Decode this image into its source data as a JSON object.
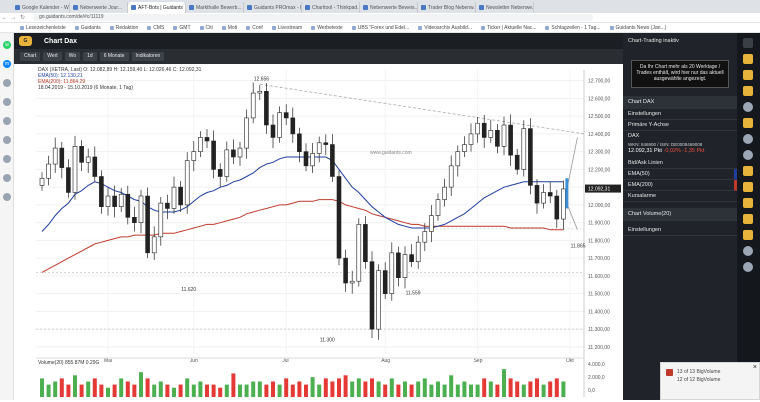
{
  "browser": {
    "tabs": [
      "Google Kalender - W...",
      "Nebenwerte Jour...",
      "AFT-Bots | Guidants",
      "Markthalle Bewerb...",
      "Guidants PROmax - H...",
      "Charttool - Thinkpad...",
      "Nebenwerte Beweis...",
      "Trader Blog Nebenw...",
      "Newsletter Nebenwe..."
    ],
    "url": "go.guidants.com/de/#c/11119",
    "bookmarks": [
      "Lesezeichenleiste",
      "Guidants",
      "Redaktion",
      "CMS",
      "GMT",
      "Citi",
      "Moti",
      "Conf",
      "Livestream",
      "Werbetexte",
      "UBS \"Forex und Edel...",
      "Videoarchiv Ausbild...",
      "Ticker | Aktuelle Nac...",
      "Schlagzeilen - 1 Tag...",
      "Guidants News (Jan...)"
    ]
  },
  "app": {
    "title": "Chart Dax",
    "toolbar": [
      "Chart",
      "Wert",
      "Wo",
      "1d",
      "6 Monate",
      "Indikatoren"
    ]
  },
  "legend": {
    "line1": "DAX (XETRA, Last) O: 12.082,89  H: 12.159,40  L: 12.026,46  C: 12.092,31",
    "line2": "EMA(50): 12.130,21",
    "line3": "EMA(200): 11.864,29",
    "line4": "18.04.2019 - 15.10.2019  (6 Monate, 1 Tag)"
  },
  "chart_data": {
    "type": "candlestick",
    "title": "",
    "instrument": "DAX",
    "x_labels": [
      "Mai",
      "Jun",
      "Jul",
      "Aug",
      "Sep",
      "Okt"
    ],
    "y_ticks": [
      11200,
      11300,
      11400,
      11500,
      11600,
      11700,
      11800,
      11900,
      12000,
      12100,
      12200,
      12300,
      12400,
      12500,
      12600,
      12700
    ],
    "y_tick_labels": [
      "11.200,00",
      "11.300,00",
      "11.400,00",
      "11.500,00",
      "11.600,00",
      "11.700,00",
      "11.800,00",
      "11.900,00",
      "12.000,00",
      "12.100,00",
      "12.200,00",
      "12.300,00",
      "12.400,00",
      "12.500,00",
      "12.600,00",
      "12.700,00"
    ],
    "ylim": [
      11160,
      12760
    ],
    "last_price_label": "12.092,31",
    "watermark": "www.guidants.com",
    "closes": [
      12150,
      12230,
      12320,
      12210,
      12070,
      12330,
      12240,
      12270,
      12160,
      11990,
      12050,
      11990,
      12060,
      11930,
      11900,
      12050,
      11730,
      11820,
      12010,
      11980,
      12100,
      12000,
      12250,
      12300,
      12380,
      12360,
      12200,
      12160,
      12310,
      12270,
      12320,
      12490,
      12630,
      12640,
      12450,
      12380,
      12520,
      12490,
      12400,
      12300,
      12220,
      12290,
      12350,
      12340,
      12160,
      11700,
      11560,
      11570,
      11890,
      11680,
      11300,
      11630,
      11500,
      11730,
      11590,
      11720,
      11680,
      11790,
      11850,
      11940,
      12030,
      12100,
      12220,
      12300,
      12340,
      12400,
      12460,
      12380,
      12420,
      12330,
      12450,
      12280,
      12200,
      12430,
      12110,
      12010,
      12070,
      12050,
      11920,
      12090
    ],
    "ema50": [
      11850,
      11890,
      11940,
      11980,
      12010,
      12060,
      12080,
      12110,
      12130,
      12120,
      12100,
      12080,
      12070,
      12050,
      12030,
      12020,
      11990,
      11970,
      11960,
      11960,
      11960,
      11970,
      11990,
      12020,
      12050,
      12070,
      12080,
      12100,
      12110,
      12130,
      12140,
      12160,
      12180,
      12210,
      12230,
      12240,
      12260,
      12270,
      12270,
      12270,
      12270,
      12270,
      12270,
      12270,
      12250,
      12200,
      12150,
      12100,
      12070,
      12030,
      11990,
      11960,
      11930,
      11910,
      11890,
      11880,
      11870,
      11870,
      11870,
      11870,
      11880,
      11890,
      11910,
      11930,
      11950,
      11980,
      12010,
      12040,
      12060,
      12080,
      12100,
      12110,
      12120,
      12130,
      12130,
      12130,
      12130,
      12130,
      12130,
      12130
    ],
    "ema200": [
      11620,
      11640,
      11660,
      11680,
      11700,
      11720,
      11740,
      11760,
      11780,
      11790,
      11800,
      11810,
      11820,
      11820,
      11830,
      11830,
      11830,
      11830,
      11840,
      11840,
      11840,
      11850,
      11860,
      11870,
      11880,
      11890,
      11890,
      11900,
      11910,
      11920,
      11930,
      11950,
      11960,
      11970,
      11980,
      11990,
      12000,
      12000,
      12010,
      12020,
      12020,
      12020,
      12030,
      12030,
      12030,
      12020,
      12000,
      11990,
      11980,
      11970,
      11950,
      11940,
      11930,
      11920,
      11910,
      11900,
      11890,
      11890,
      11880,
      11880,
      11880,
      11880,
      11880,
      11880,
      11880,
      11880,
      11880,
      11880,
      11880,
      11880,
      11880,
      11870,
      11870,
      11870,
      11870,
      11870,
      11870,
      11860,
      11860,
      11860
    ],
    "annotations": [
      {
        "text": "12.656",
        "x_index": 33,
        "y": 12700
      },
      {
        "text": "11.620",
        "x_index": 22,
        "y": 11515
      },
      {
        "text": "11.559",
        "x_index": 56,
        "y": 11495
      },
      {
        "text": "11.300",
        "x_index": 43,
        "y": 11230
      },
      {
        "text": "11.865",
        "x_index": 81,
        "y": 11760
      }
    ],
    "volume_legend": "Volume(20)  855.87M  0.29G",
    "volume_ticks": [
      "4.000,0",
      "2.000,0",
      "0,0"
    ],
    "volumes": [
      3,
      2,
      2.5,
      3,
      2,
      3.5,
      2,
      2.5,
      3,
      2,
      1.5,
      2,
      3,
      2.5,
      2,
      4,
      3,
      2,
      2.5,
      2,
      1.5,
      2,
      3,
      2,
      2.5,
      2,
      2,
      1.5,
      2,
      3.8,
      2,
      2,
      2.5,
      2.5,
      2,
      2.5,
      2,
      3,
      2,
      2.5,
      2,
      3.2,
      2,
      3,
      2.5,
      3,
      3.5,
      2.5,
      3,
      2.5,
      3,
      2.5,
      2,
      3,
      2,
      2.5,
      2,
      2.5,
      3,
      2,
      2.5,
      2,
      3.5,
      2,
      2.5,
      2,
      2,
      3,
      2.5,
      2,
      4.5,
      3,
      2.5,
      2,
      2.5,
      3,
      2,
      2.5,
      3,
      2.5
    ]
  },
  "right_panel": {
    "header": "Chart-Trading inaktiv",
    "tip": "Da Ihr Chart mehr als 20 Werktage / Trades enthält, wird hier nur das aktuell ausgewählte angezeigt.",
    "section_chart": "Chart DAX",
    "einstellungen": "Einstellungen",
    "primaere_achse": "Primäre Y-Achse",
    "instrument": "DAX",
    "isin": "WKN: 846900 / ISIN: DE0008469008",
    "price": "12.092,31 Pkt",
    "change": "-0,02%  -1,35 Pkt",
    "bid_ask": "Bid/Ask Linien",
    "ema50": "EMA(50)",
    "ema200": "EMA(200)",
    "kursalarme": "Kursalarme",
    "section_volume": "Chart Volume(20)",
    "volume_settings": "Einstellungen"
  },
  "notification": {
    "text": "13 of 13 BigVolume",
    "sub": "12 of 12 BigVolume"
  }
}
